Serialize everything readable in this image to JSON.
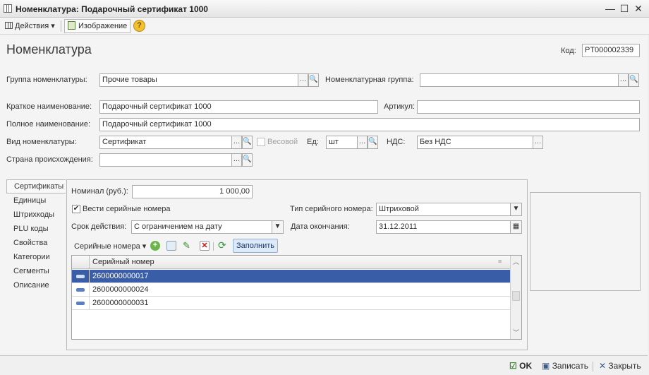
{
  "window": {
    "title": "Номенклатура: Подарочный сертификат 1000",
    "minimize": "—",
    "maximize": "☐",
    "close": "✕"
  },
  "toolbar": {
    "actions": "Действия",
    "image": "Изображение",
    "help": "?"
  },
  "header": {
    "title": "Номенклатура",
    "code_label": "Код:",
    "code_value": "PT000002339"
  },
  "fields": {
    "group_label": "Группа номенклатуры:",
    "group_value": "Прочие товары",
    "nom_group_label": "Номенклатурная группа:",
    "nom_group_value": "",
    "short_name_label": "Краткое наименование:",
    "short_name_value": "Подарочный сертификат 1000",
    "article_label": "Артикул:",
    "article_value": "",
    "full_name_label": "Полное наименование:",
    "full_name_value": "Подарочный сертификат 1000",
    "kind_label": "Вид номенклатуры:",
    "kind_value": "Сертификат",
    "weight_label": "Весовой",
    "unit_label": "Ед:",
    "unit_value": "шт",
    "vat_label": "НДС:",
    "vat_value": "Без НДС",
    "country_label": "Страна происхождения:",
    "country_value": ""
  },
  "tabs": [
    {
      "label": "Сертификаты"
    },
    {
      "label": "Единицы"
    },
    {
      "label": "Штрихкоды"
    },
    {
      "label": "PLU коды"
    },
    {
      "label": "Свойства"
    },
    {
      "label": "Категории"
    },
    {
      "label": "Сегменты"
    },
    {
      "label": "Описание"
    }
  ],
  "certificates": {
    "nominal_label": "Номинал (руб.):",
    "nominal_value": "1 000,00",
    "serial_check_label": "Вести серийные номера",
    "serial_type_label": "Тип серийного номера:",
    "serial_type_value": "Штриховой",
    "validity_label": "Срок действия:",
    "validity_value": "С ограничением на дату",
    "end_date_label": "Дата окончания:",
    "end_date_value": "31.12.2011",
    "serials_menu": "Серийные номера",
    "fill_button": "Заполнить",
    "column_header": "Серийный номер",
    "rows": [
      "2600000000017",
      "2600000000024",
      "2600000000031"
    ]
  },
  "footer": {
    "ok": "OK",
    "save": "Записать",
    "close": "Закрыть"
  }
}
